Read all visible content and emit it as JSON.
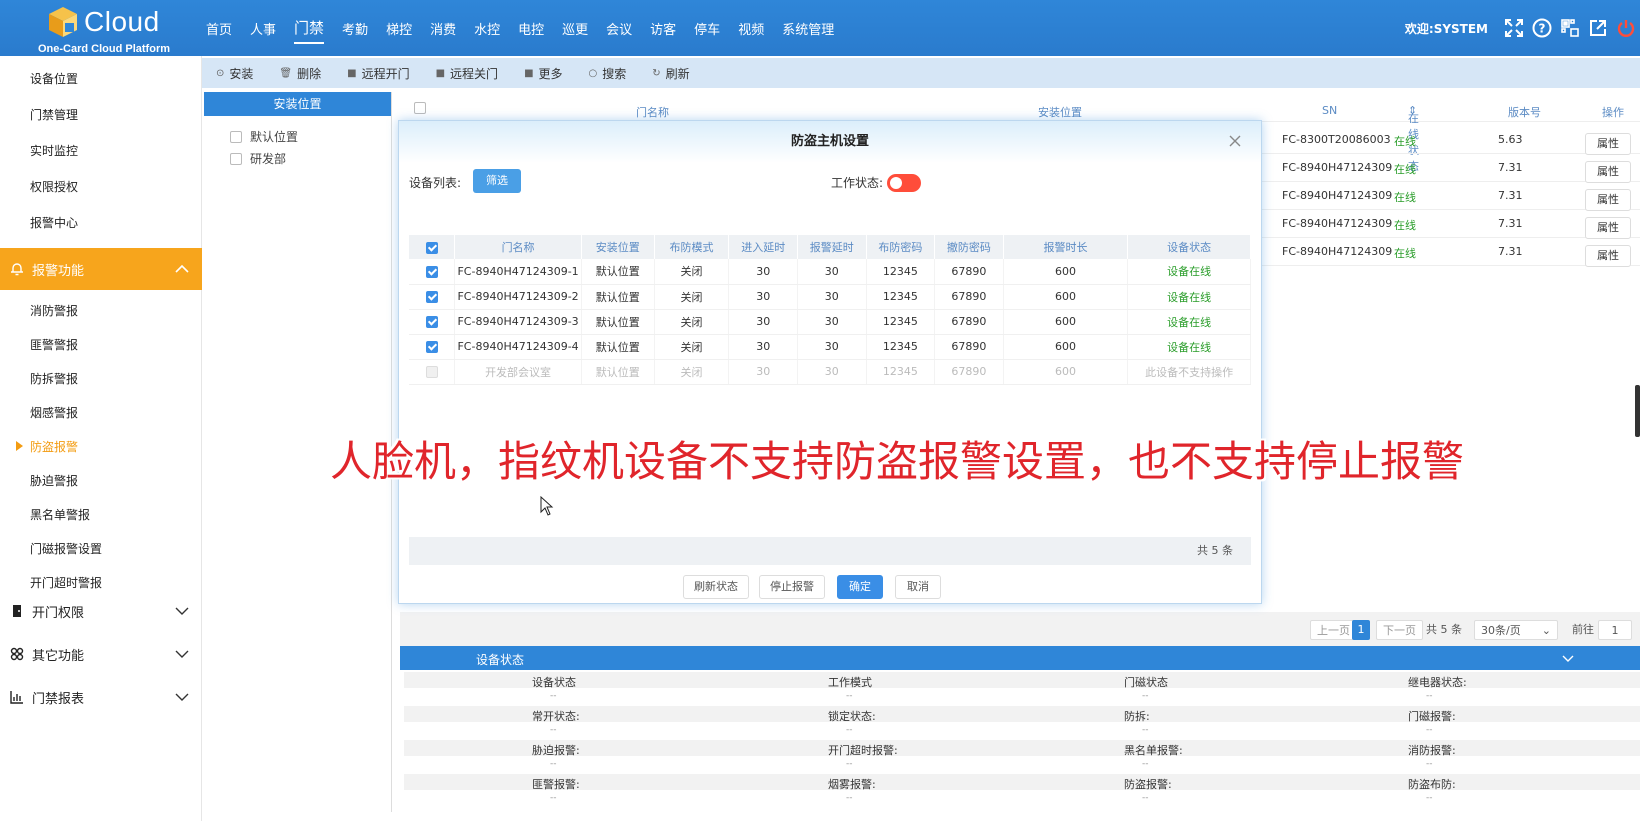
{
  "header": {
    "logo_text": "Cloud",
    "logo_sub": "One-Card Cloud Platform",
    "nav": [
      "首页",
      "人事",
      "门禁",
      "考勤",
      "梯控",
      "消费",
      "水控",
      "电控",
      "巡更",
      "会议",
      "访客",
      "停车",
      "视频",
      "系统管理"
    ],
    "active_nav": "门禁",
    "welcome": "欢迎:SYSTEM",
    "icons": [
      "fullscreen-icon",
      "help-icon",
      "qr-icon",
      "external-link-icon",
      "power-icon"
    ]
  },
  "sidebar": {
    "top_items": [
      "设备位置",
      "门禁管理",
      "实时监控",
      "权限授权",
      "报警中心"
    ],
    "alarm_group": "报警功能",
    "alarm_items": [
      "消防警报",
      "匪警警报",
      "防拆警报",
      "烟感警报",
      "防盗报警",
      "胁迫警报",
      "黑名单警报",
      "门磁报警设置",
      "开门超时警报"
    ],
    "current_item": "防盗报警",
    "groups": [
      "开门权限",
      "其它功能",
      "门禁报表"
    ]
  },
  "toolbar": {
    "buttons": [
      "安装",
      "删除",
      "远程开门",
      "远程关门",
      "更多",
      "搜索",
      "刷新"
    ]
  },
  "tree": {
    "header": "安装位置",
    "nodes": [
      "默认位置",
      "研发部"
    ]
  },
  "device_table": {
    "headers": [
      "门名称",
      "安装位置",
      "SN",
      "在线状态",
      "版本号",
      "操作"
    ],
    "rows": [
      {
        "sn": "FC-8300T20086003",
        "status": "在线",
        "version": "5.63",
        "action": "属性"
      },
      {
        "sn": "FC-8940H47124309",
        "status": "在线",
        "version": "7.31",
        "action": "属性"
      },
      {
        "sn": "FC-8940H47124309",
        "status": "在线",
        "version": "7.31",
        "action": "属性"
      },
      {
        "sn": "FC-8940H47124309",
        "status": "在线",
        "version": "7.31",
        "action": "属性"
      },
      {
        "sn": "FC-8940H47124309",
        "status": "在线",
        "version": "7.31",
        "action": "属性"
      }
    ]
  },
  "pager": {
    "prev": "上一页",
    "current": "1",
    "next": "下一页",
    "total": "共 5 条",
    "page_size": "30条/页",
    "goto_label": "前往",
    "goto_value": "1"
  },
  "status_panel": {
    "title": "设备状态",
    "rows": [
      [
        "设备状态",
        "工作模式",
        "门磁状态",
        "继电器状态:"
      ],
      [
        "常开状态:",
        "锁定状态:",
        "防拆:",
        "门磁报警:"
      ],
      [
        "胁迫报警:",
        "开门超时报警:",
        "黑名单报警:",
        "消防报警:"
      ],
      [
        "匪警报警:",
        "烟雾报警:",
        "防盗报警:",
        "防盗布防:"
      ]
    ],
    "empty_value": "--"
  },
  "modal": {
    "title": "防盗主机设置",
    "device_list_label": "设备列表:",
    "filter_label": "筛选",
    "work_status_label": "工作状态:",
    "work_status_on": true,
    "columns": [
      "门名称",
      "安装位置",
      "布防模式",
      "进入延时",
      "报警延时",
      "布防密码",
      "撤防密码",
      "报警时长",
      "设备状态"
    ],
    "rows": [
      {
        "checked": true,
        "name": "FC-8940H47124309-1",
        "location": "默认位置",
        "mode": "关闭",
        "enter_delay": "30",
        "alarm_delay": "30",
        "arm_pwd": "12345",
        "disarm_pwd": "67890",
        "duration": "600",
        "state": "设备在线",
        "disabled": false
      },
      {
        "checked": true,
        "name": "FC-8940H47124309-2",
        "location": "默认位置",
        "mode": "关闭",
        "enter_delay": "30",
        "alarm_delay": "30",
        "arm_pwd": "12345",
        "disarm_pwd": "67890",
        "duration": "600",
        "state": "设备在线",
        "disabled": false
      },
      {
        "checked": true,
        "name": "FC-8940H47124309-3",
        "location": "默认位置",
        "mode": "关闭",
        "enter_delay": "30",
        "alarm_delay": "30",
        "arm_pwd": "12345",
        "disarm_pwd": "67890",
        "duration": "600",
        "state": "设备在线",
        "disabled": false
      },
      {
        "checked": true,
        "name": "FC-8940H47124309-4",
        "location": "默认位置",
        "mode": "关闭",
        "enter_delay": "30",
        "alarm_delay": "30",
        "arm_pwd": "12345",
        "disarm_pwd": "67890",
        "duration": "600",
        "state": "设备在线",
        "disabled": false
      },
      {
        "checked": false,
        "name": "开发部会议室",
        "location": "默认位置",
        "mode": "关闭",
        "enter_delay": "30",
        "alarm_delay": "30",
        "arm_pwd": "12345",
        "disarm_pwd": "67890",
        "duration": "600",
        "state": "此设备不支持操作",
        "disabled": true
      }
    ],
    "total": "共 5 条",
    "buttons": {
      "refresh": "刷新状态",
      "stop": "停止报警",
      "confirm": "确定",
      "cancel": "取消"
    }
  },
  "caption": "人脸机，指纹机设备不支持防盗报警设置，也不支持停止报警",
  "colors": {
    "primary": "#2f86d8",
    "accent": "#f7a51c",
    "online": "#2a9d2a",
    "caption": "#e0252b",
    "toggle_on": "#ff4d3a"
  }
}
